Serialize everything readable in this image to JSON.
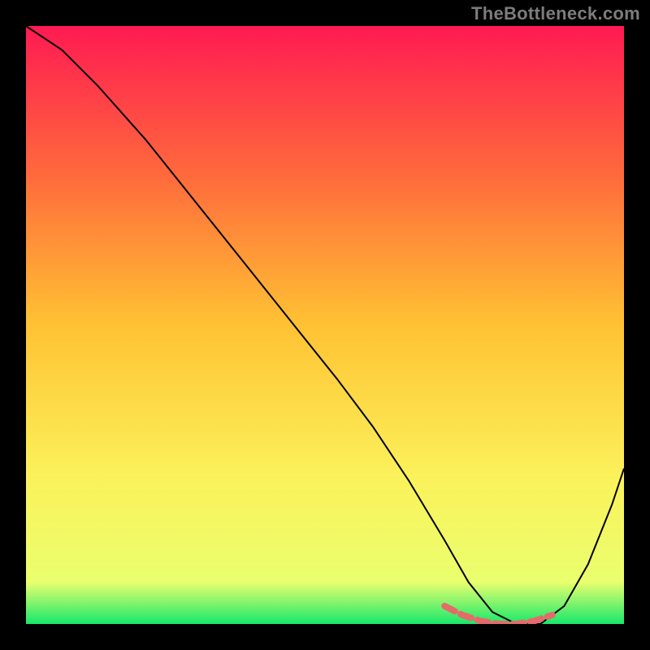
{
  "watermark": "TheBottleneck.com",
  "chart_data": {
    "type": "line",
    "title": "",
    "xlabel": "",
    "ylabel": "",
    "xlim": [
      0,
      100
    ],
    "ylim": [
      0,
      100
    ],
    "grid": false,
    "legend": null,
    "background_gradient": {
      "stops": [
        {
          "offset": 0.0,
          "color": "#ff1a52"
        },
        {
          "offset": 0.25,
          "color": "#ff6a3c"
        },
        {
          "offset": 0.5,
          "color": "#ffc233"
        },
        {
          "offset": 0.75,
          "color": "#fbf15a"
        },
        {
          "offset": 0.93,
          "color": "#eaff6e"
        },
        {
          "offset": 1.0,
          "color": "#17e86b"
        }
      ]
    },
    "series": [
      {
        "name": "bottleneck-curve",
        "color": "#000000",
        "stroke_width": 2,
        "x": [
          0,
          6,
          12,
          20,
          28,
          36,
          44,
          52,
          58,
          64,
          70,
          74,
          78,
          82,
          86,
          90,
          94,
          98,
          100
        ],
        "y": [
          100,
          96,
          90,
          81,
          71,
          61,
          51,
          41,
          33,
          24,
          14,
          7,
          2,
          0,
          0,
          3,
          10,
          20,
          26
        ]
      },
      {
        "name": "optimal-region-highlight",
        "color": "#e66a6a",
        "stroke_width": 8,
        "x": [
          70,
          73,
          76,
          79,
          82,
          85,
          88
        ],
        "y": [
          3,
          1.5,
          0.5,
          0,
          0,
          0.5,
          1.5
        ]
      }
    ],
    "optimal_range_x": [
      70,
      88
    ]
  }
}
